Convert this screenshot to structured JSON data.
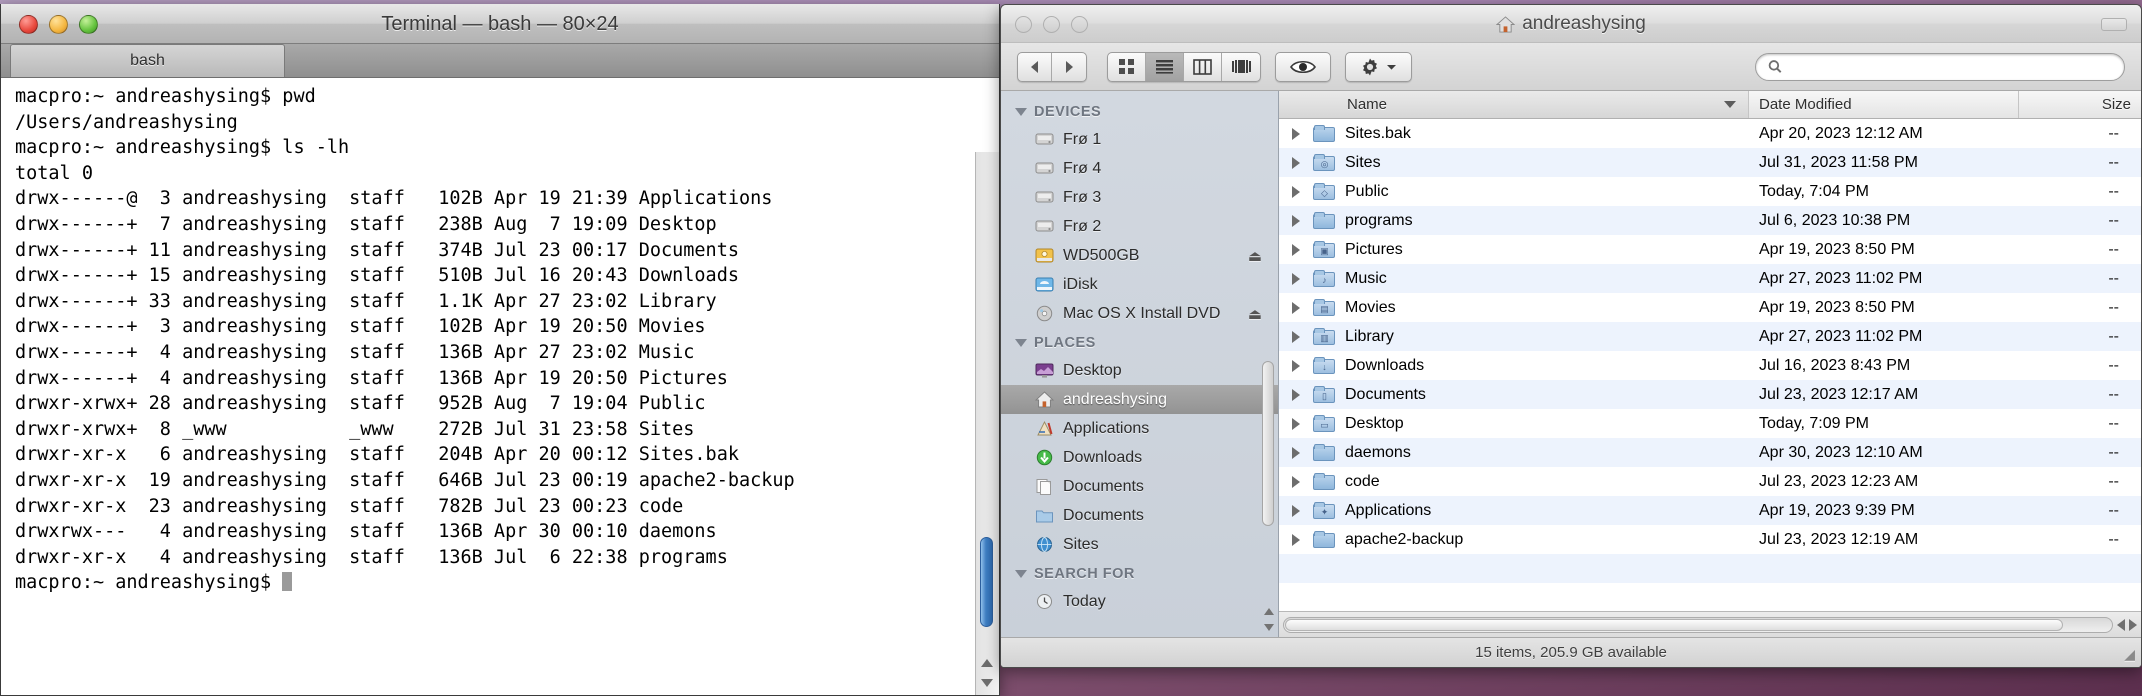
{
  "terminal": {
    "title": "Terminal — bash — 80×24",
    "tab_label": "bash",
    "content": "macpro:~ andreashysing$ pwd\n/Users/andreashysing\nmacpro:~ andreashysing$ ls -lh\ntotal 0\ndrwx------@  3 andreashysing  staff   102B Apr 19 21:39 Applications\ndrwx------+  7 andreashysing  staff   238B Aug  7 19:09 Desktop\ndrwx------+ 11 andreashysing  staff   374B Jul 23 00:17 Documents\ndrwx------+ 15 andreashysing  staff   510B Jul 16 20:43 Downloads\ndrwx------+ 33 andreashysing  staff   1.1K Apr 27 23:02 Library\ndrwx------+  3 andreashysing  staff   102B Apr 19 20:50 Movies\ndrwx------+  4 andreashysing  staff   136B Apr 27 23:02 Music\ndrwx------+  4 andreashysing  staff   136B Apr 19 20:50 Pictures\ndrwxr-xrwx+ 28 andreashysing  staff   952B Aug  7 19:04 Public\ndrwxr-xrwx+  8 _www           _www    272B Jul 31 23:58 Sites\ndrwxr-xr-x   6 andreashysing  staff   204B Apr 20 00:12 Sites.bak\ndrwxr-xr-x  19 andreashysing  staff   646B Jul 23 00:19 apache2-backup\ndrwxr-xr-x  23 andreashysing  staff   782B Jul 23 00:23 code\ndrwxrwx---   4 andreashysing  staff   136B Apr 30 00:10 daemons\ndrwxr-xr-x   4 andreashysing  staff   136B Jul  6 22:38 programs\nmacpro:~ andreashysing$ "
  },
  "finder": {
    "title": "andreashysing",
    "toolbar": {
      "view_modes": [
        "icon-view",
        "list-view",
        "column-view",
        "coverflow-view"
      ],
      "active_view": "list-view",
      "quicklook_label": "",
      "action_label": ""
    },
    "search": {
      "value": "",
      "placeholder": ""
    },
    "sidebar": {
      "sections": [
        {
          "header": "DEVICES",
          "items": [
            {
              "label": "Frø 1",
              "icon": "hard-disk-icon",
              "eject": false
            },
            {
              "label": "Frø 4",
              "icon": "hard-disk-icon",
              "eject": false
            },
            {
              "label": "Frø 3",
              "icon": "hard-disk-icon",
              "eject": false
            },
            {
              "label": "Frø 2",
              "icon": "hard-disk-icon",
              "eject": false
            },
            {
              "label": "WD500GB",
              "icon": "external-disk-icon",
              "eject": true
            },
            {
              "label": "iDisk",
              "icon": "idisk-icon",
              "eject": false
            },
            {
              "label": "Mac OS X Install DVD",
              "icon": "dvd-icon",
              "eject": true
            }
          ]
        },
        {
          "header": "PLACES",
          "items": [
            {
              "label": "Desktop",
              "icon": "desktop-icon",
              "eject": false
            },
            {
              "label": "andreashysing",
              "icon": "home-icon",
              "eject": false,
              "selected": true
            },
            {
              "label": "Applications",
              "icon": "applications-icon",
              "eject": false
            },
            {
              "label": "Downloads",
              "icon": "downloads-icon",
              "eject": false
            },
            {
              "label": "Documents",
              "icon": "documents-alias-icon",
              "eject": false
            },
            {
              "label": "Documents",
              "icon": "folder-icon",
              "eject": false
            },
            {
              "label": "Sites",
              "icon": "sites-globe-icon",
              "eject": false
            }
          ]
        },
        {
          "header": "SEARCH FOR",
          "items": [
            {
              "label": "Today",
              "icon": "clock-icon",
              "eject": false
            }
          ]
        }
      ]
    },
    "columns": {
      "name": "Name",
      "date": "Date Modified",
      "size": "Size"
    },
    "rows": [
      {
        "name": "Sites.bak",
        "icon": "folder-icon",
        "date": "Apr 20, 2023 12:12 AM",
        "size": "--"
      },
      {
        "name": "Sites",
        "icon": "sites-folder-icon",
        "date": "Jul 31, 2023 11:58 PM",
        "size": "--"
      },
      {
        "name": "Public",
        "icon": "public-folder-icon",
        "date": "Today, 7:04 PM",
        "size": "--"
      },
      {
        "name": "programs",
        "icon": "folder-icon",
        "date": "Jul 6, 2023 10:38 PM",
        "size": "--"
      },
      {
        "name": "Pictures",
        "icon": "pictures-folder-icon",
        "date": "Apr 19, 2023 8:50 PM",
        "size": "--"
      },
      {
        "name": "Music",
        "icon": "music-folder-icon",
        "date": "Apr 27, 2023 11:02 PM",
        "size": "--"
      },
      {
        "name": "Movies",
        "icon": "movies-folder-icon",
        "date": "Apr 19, 2023 8:50 PM",
        "size": "--"
      },
      {
        "name": "Library",
        "icon": "library-folder-icon",
        "date": "Apr 27, 2023 11:02 PM",
        "size": "--"
      },
      {
        "name": "Downloads",
        "icon": "downloads-folder-icon",
        "date": "Jul 16, 2023 8:43 PM",
        "size": "--"
      },
      {
        "name": "Documents",
        "icon": "documents-folder-icon",
        "date": "Jul 23, 2023 12:17 AM",
        "size": "--"
      },
      {
        "name": "Desktop",
        "icon": "desktop-folder-icon",
        "date": "Today, 7:09 PM",
        "size": "--"
      },
      {
        "name": "daemons",
        "icon": "folder-icon",
        "date": "Apr 30, 2023 12:10 AM",
        "size": "--"
      },
      {
        "name": "code",
        "icon": "folder-icon",
        "date": "Jul 23, 2023 12:23 AM",
        "size": "--"
      },
      {
        "name": "Applications",
        "icon": "applications-folder-icon",
        "date": "Apr 19, 2023 9:39 PM",
        "size": "--"
      },
      {
        "name": "apache2-backup",
        "icon": "folder-icon",
        "date": "Jul 23, 2023 12:19 AM",
        "size": "--"
      }
    ],
    "status": "15 items, 205.9 GB available"
  }
}
